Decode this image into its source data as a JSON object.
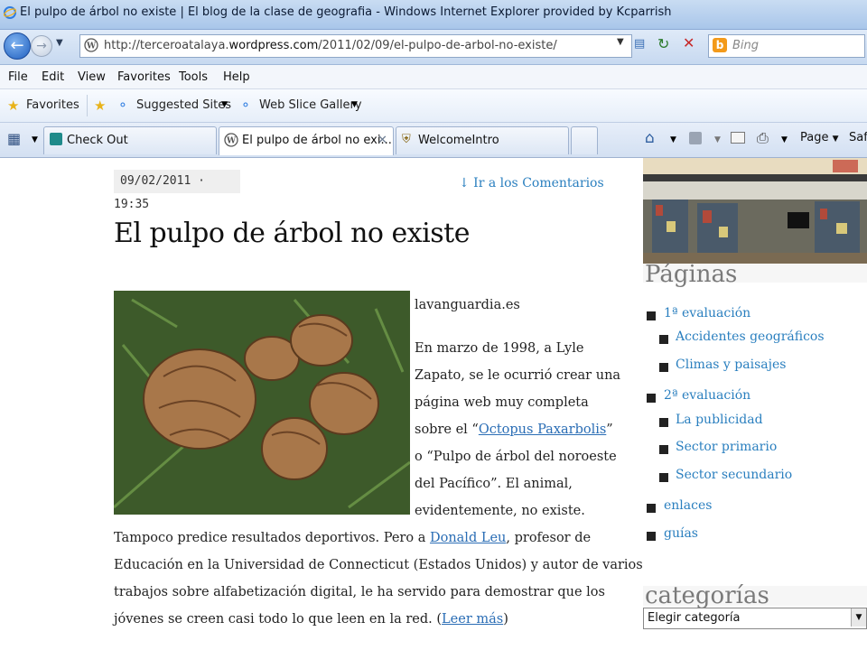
{
  "window": {
    "title": "El pulpo de árbol no existe | El blog de la clase de geografia - Windows Internet Explorer provided by Kcparrish"
  },
  "address": {
    "url_prefix": "http://terceroatalaya.",
    "url_domain": "wordpress.com",
    "url_path": "/2011/02/09/el-pulpo-de-arbol-no-existe/",
    "search_placeholder": "Bing"
  },
  "menu": {
    "items": [
      "File",
      "Edit",
      "View",
      "Favorites",
      "Tools",
      "Help"
    ]
  },
  "favorites_bar": {
    "favorites_label": "Favorites",
    "suggested_sites": "Suggested Sites",
    "web_slice": "Web Slice Gallery"
  },
  "tabs": [
    {
      "label": "Check Out"
    },
    {
      "label": "El pulpo de árbol no exi..."
    },
    {
      "label": "WelcomeIntro"
    }
  ],
  "command_bar": {
    "page_label": "Page",
    "safety_label": "Safe"
  },
  "post": {
    "date": "09/02/2011 · 19:35",
    "comments_link": "↓ Ir a los Comentarios",
    "title": "El pulpo de árbol no existe",
    "source": "lavanguardia.es",
    "lines": [
      "En marzo de 1998, a Lyle",
      "Zapato, se le ocurrió crear una",
      "página web muy completa"
    ],
    "line4_pre": "sobre el “",
    "line4_link": "Octopus Paxarbolis",
    "line4_post": "”",
    "lines2": [
      "o “Pulpo de árbol del noroeste",
      "del Pacífico”. El animal,",
      "evidentemente, no existe."
    ],
    "wide_pre": "Tampoco predice resultados deportivos. Pero a ",
    "wide_link": "Donald Leu",
    "wide_post": ", profesor de",
    "wide_lines": [
      "Educación en la Universidad de Connecticut (Estados Unidos) y autor de varios",
      "trabajos sobre alfabetización digital, le ha servido para demostrar que los"
    ],
    "last_pre": "jóvenes se creen casi todo lo que leen en la red. (",
    "last_link": "Leer más",
    "last_post": ")"
  },
  "sidebar": {
    "pages_heading": "Páginas",
    "items": [
      {
        "label": "1ª evaluación",
        "level": 0
      },
      {
        "label": "Accidentes geográficos",
        "level": 1
      },
      {
        "label": "Climas y paisajes",
        "level": 1
      },
      {
        "label": "2ª evaluación",
        "level": 0
      },
      {
        "label": "La publicidad",
        "level": 1
      },
      {
        "label": "Sector primario",
        "level": 1
      },
      {
        "label": "Sector secundario",
        "level": 1
      },
      {
        "label": "enlaces",
        "level": 0
      },
      {
        "label": "guías",
        "level": 0
      }
    ],
    "categories_heading": "categorías",
    "category_select": "Elegir categoría"
  }
}
